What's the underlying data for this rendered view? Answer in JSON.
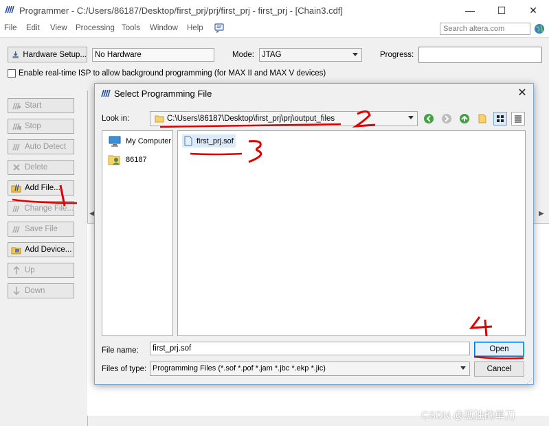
{
  "window": {
    "title": "Programmer - C:/Users/86187/Desktop/first_prj/prj/first_prj - first_prj - [Chain3.cdf]",
    "minimize": "—",
    "maximize": "☐",
    "close": "✕"
  },
  "menu": [
    "File",
    "Edit",
    "View",
    "Processing",
    "Tools",
    "Window",
    "Help"
  ],
  "search": {
    "placeholder": "Search altera.com"
  },
  "toolbar": {
    "hardware_setup": "Hardware Setup...",
    "hardware_value": "No Hardware",
    "mode_label": "Mode:",
    "mode_value": "JTAG",
    "progress_label": "Progress:",
    "isp_label": "Enable real-time ISP to allow background programming (for MAX II and MAX V devices)"
  },
  "sidebar": {
    "items": [
      {
        "label": "Start",
        "enabled": false
      },
      {
        "label": "Stop",
        "enabled": false
      },
      {
        "label": "Auto Detect",
        "enabled": false
      },
      {
        "label": "Delete",
        "enabled": false
      },
      {
        "label": "Add File...",
        "enabled": true
      },
      {
        "label": "Change File...",
        "enabled": false
      },
      {
        "label": "Save File",
        "enabled": false
      },
      {
        "label": "Add Device...",
        "enabled": true
      },
      {
        "label": "Up",
        "enabled": false
      },
      {
        "label": "Down",
        "enabled": false
      }
    ]
  },
  "dialog": {
    "title": "Select Programming File",
    "close": "✕",
    "look_in_label": "Look in:",
    "look_in_value": "C:\\Users\\86187\\Desktop\\first_prj\\prj\\output_files",
    "places": [
      "My Computer",
      "86187"
    ],
    "files": [
      "first_prj.sof"
    ],
    "file_name_label": "File name:",
    "file_name_value": "first_prj.sof",
    "file_type_label": "Files of type:",
    "file_type_value": "Programming Files (*.sof *.pof *.jam *.jbc *.ekp *.jic)",
    "open": "Open",
    "cancel": "Cancel"
  },
  "annotations": [
    "1",
    "2",
    "3",
    "4"
  ],
  "watermark": "CSDN @孤独的单刀",
  "colors": {
    "accent": "#0078d7",
    "annotation": "#e00000",
    "selection": "#dbe9f8"
  }
}
